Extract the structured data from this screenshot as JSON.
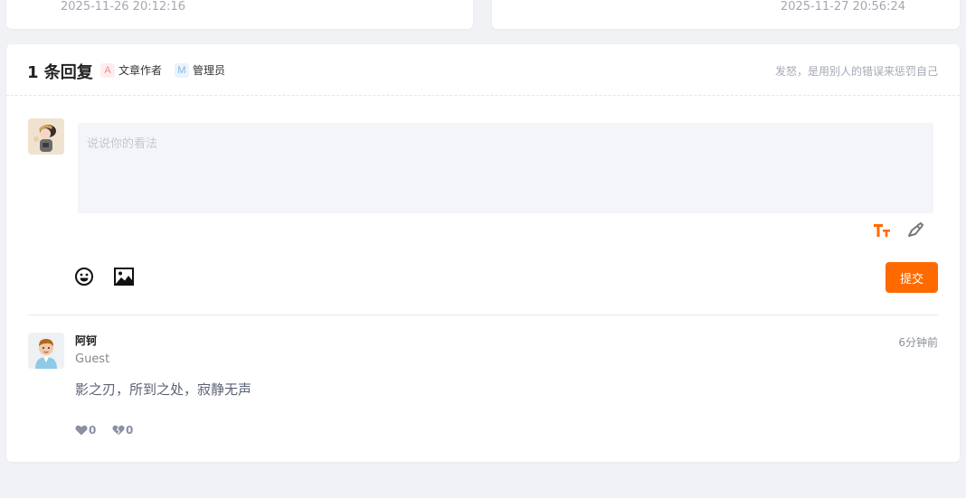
{
  "top_cards": {
    "left_date": "2025-11-26 20:12:16",
    "right_date": "2025-11-27 20:56:24"
  },
  "header": {
    "reply_count": "1 条回复",
    "author_tag_letter": "A",
    "author_tag_label": "文章作者",
    "admin_tag_letter": "M",
    "admin_tag_label": "管理员",
    "motto": "发怒，是用别人的错误来惩罚自己"
  },
  "composer": {
    "placeholder": "说说你的看法",
    "submit_label": "提交"
  },
  "comments": [
    {
      "name": "阿钶",
      "role": "Guest",
      "time": "6分钟前",
      "text": "影之刃，所到之处，寂静无声",
      "likes": "0",
      "dislikes": "0"
    }
  ],
  "colors": {
    "accent": "#ff6a00",
    "background": "#f1f2f5"
  }
}
